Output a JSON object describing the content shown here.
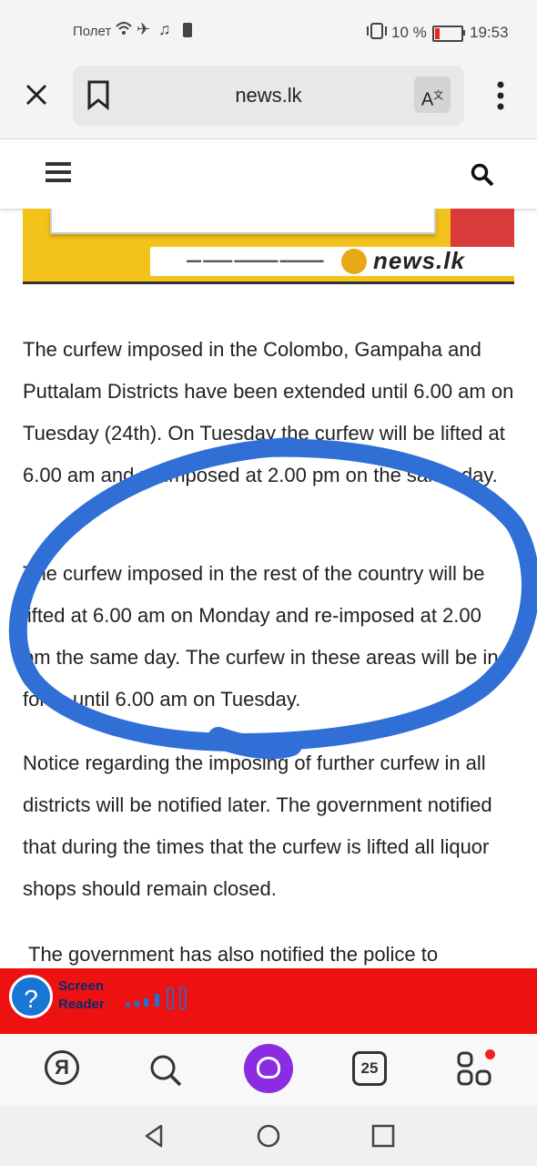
{
  "status_bar": {
    "carrier": "Полет",
    "battery_percent": "10 %",
    "time": "19:53",
    "icons": [
      "wifi-icon",
      "airplane-icon",
      "music-icon",
      "sim-icon",
      "vibrate-icon",
      "battery-icon"
    ]
  },
  "browser": {
    "url": "news.lk",
    "translate_label": "A"
  },
  "banner": {
    "logo": "news.lk"
  },
  "article": {
    "paragraphs": [
      "The curfew imposed in the Colombo, Gampaha and Puttalam Districts have been extended until 6.00 am on Tuesday (24th). On Tuesday the curfew will be lifted at 6.00 am and re-imposed at 2.00 pm on the same day.",
      "The curfew imposed in the rest of the country will be lifted at 6.00 am on Monday and re-imposed at 2.00 pm the same day. The curfew in these areas will be in force until 6.00 am on Tuesday.",
      "Notice regarding the imposing of further curfew in all districts will be notified later. The government notified that during the times that the curfew is lifted all liquor shops should remain closed.",
      "The government has also notified the police to"
    ]
  },
  "screen_reader": {
    "label": "Screen Reader"
  },
  "bottom_nav": {
    "yandex_label": "Я",
    "tabs_count": "25"
  },
  "colors": {
    "scribble": "#2f6fd6",
    "screen_reader_bar": "#ee1111",
    "alice": "#8b2be2",
    "banner_yellow": "#f3c21b"
  }
}
